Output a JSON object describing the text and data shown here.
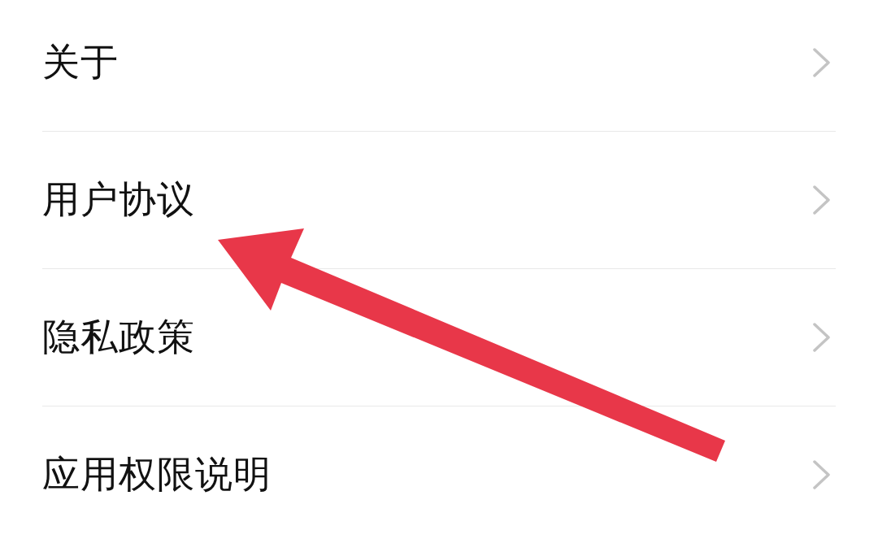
{
  "settings_list": {
    "items": [
      {
        "label": "关于"
      },
      {
        "label": "用户协议"
      },
      {
        "label": "隐私政策"
      },
      {
        "label": "应用权限说明"
      }
    ]
  }
}
